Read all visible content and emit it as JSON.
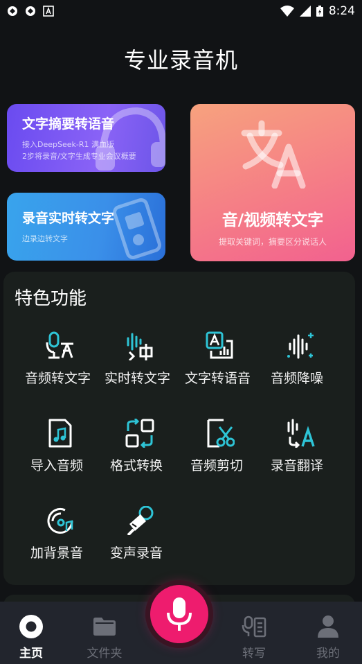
{
  "status_bar": {
    "time": "8:24",
    "left_icons": [
      "app-notification-icon",
      "app-notification-icon",
      "a-notification-icon"
    ],
    "right_icons": [
      "wifi-icon",
      "signal-icon",
      "battery-icon"
    ]
  },
  "header": {
    "title": "专业录音机"
  },
  "cards": {
    "summary": {
      "title": "文字摘要转语音",
      "sub_line1": "接入DeepSeek-R1 满血版",
      "sub_line2": "2步将录音/文字生成专业会议概要",
      "icon": "headphones-icon"
    },
    "realtime": {
      "title": "录音实时转文字",
      "sub": "边录边转文字",
      "icon": "recorder-icon"
    },
    "av": {
      "title": "音/视频转文字",
      "sub": "提取关键词，摘要区分说话人",
      "icon": "translate-icon"
    }
  },
  "features": {
    "heading": "特色功能",
    "items": [
      {
        "label": "音频转文字",
        "icon": "audio-to-text-icon"
      },
      {
        "label": "实时转文字",
        "icon": "realtime-transcribe-icon"
      },
      {
        "label": "文字转语音",
        "icon": "text-to-speech-icon"
      },
      {
        "label": "音频降噪",
        "icon": "noise-reduction-icon"
      },
      {
        "label": "导入音频",
        "icon": "import-audio-icon"
      },
      {
        "label": "格式转换",
        "icon": "format-convert-icon"
      },
      {
        "label": "音频剪切",
        "icon": "audio-cut-icon"
      },
      {
        "label": "录音翻译",
        "icon": "recording-translate-icon"
      },
      {
        "label": "加背景音",
        "icon": "background-music-icon"
      },
      {
        "label": "变声录音",
        "icon": "voice-changer-icon"
      }
    ]
  },
  "nav": {
    "items": [
      {
        "label": "主页",
        "icon": "home-icon",
        "active": true
      },
      {
        "label": "文件夹",
        "icon": "folder-icon",
        "active": false
      },
      {
        "label": "转写",
        "icon": "transcribe-icon",
        "active": false
      },
      {
        "label": "我的",
        "icon": "profile-icon",
        "active": false
      }
    ],
    "record_icon": "microphone-icon"
  },
  "colors": {
    "accent": "#ee1c6e",
    "feature_icon_primary": "#ffffff",
    "feature_icon_accent": "#2ec4d6",
    "background": "#111315",
    "panel": "#1a1f1d"
  }
}
